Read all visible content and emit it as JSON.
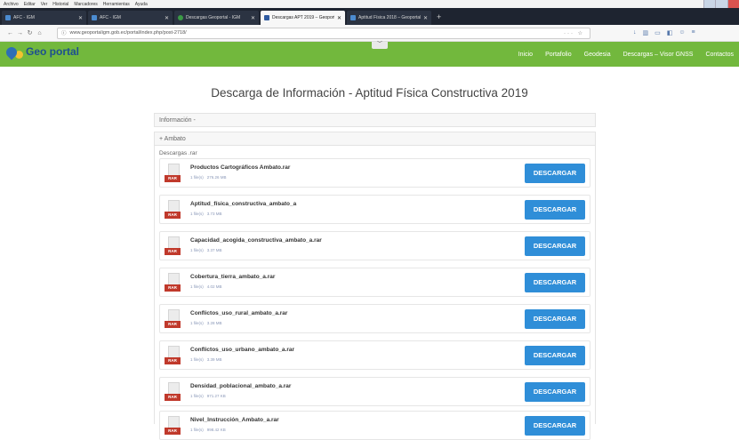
{
  "menubar": [
    "Archivo",
    "Editar",
    "Ver",
    "Historial",
    "Marcadores",
    "Herramientas",
    "Ayuda"
  ],
  "tabs": [
    {
      "label": "AFC - IGM",
      "active": false
    },
    {
      "label": "AFC - IGM",
      "active": false
    },
    {
      "label": "Descargas Geoportal - IGM",
      "active": false
    },
    {
      "label": "Descargas APT 2019 – Geoportal",
      "active": true
    },
    {
      "label": "Aptitud Física 2018 – Geoportal",
      "active": false
    }
  ],
  "url": "www.geoportaligm.gob.ec/portal/index.php/post-2718/",
  "page_actions": "··· ☆",
  "logo": "Geo portal",
  "site_menu": [
    "Inicio",
    "Portafolio",
    "Geodesia",
    "Descargas – Visor GNSS",
    "Contactos"
  ],
  "page_title": "Descarga de Información - Aptitud Física Constructiva 2019",
  "panels": {
    "informacion": "Información -",
    "ambato": "+ Ambato"
  },
  "downloads_header": "Descargas .rar",
  "button_label": "DESCARGAR",
  "file_tag": "RAR",
  "files": [
    {
      "name": "Productos Cartográficos Ambato.rar",
      "count": "1 file(s)",
      "size": "276.26 MB"
    },
    {
      "name": "Aptitud_física_constructiva_ambato_a",
      "count": "1 file(s)",
      "size": "3.73 MB"
    },
    {
      "name": "Capacidad_acogida_constructiva_ambato_a.rar",
      "count": "1 file(s)",
      "size": "3.37 MB"
    },
    {
      "name": "Cobertura_tierra_ambato_a.rar",
      "count": "1 file(s)",
      "size": "4.02 MB"
    },
    {
      "name": "Conflictos_uso_rural_ambato_a.rar",
      "count": "1 file(s)",
      "size": "3.28 MB"
    },
    {
      "name": "Conflictos_uso_urbano_ambato_a.rar",
      "count": "1 file(s)",
      "size": "3.39 MB"
    },
    {
      "name": "Densidad_poblacional_ambato_a.rar",
      "count": "1 file(s)",
      "size": "971.27 KB"
    },
    {
      "name": "Nivel_Instrucción_Ambato_a.rar",
      "count": "1 file(s)",
      "size": "998.42 KB"
    }
  ],
  "colors": {
    "site_nav": "#72b83d",
    "button": "#2f8ed8",
    "rar_tag": "#c0392b"
  }
}
